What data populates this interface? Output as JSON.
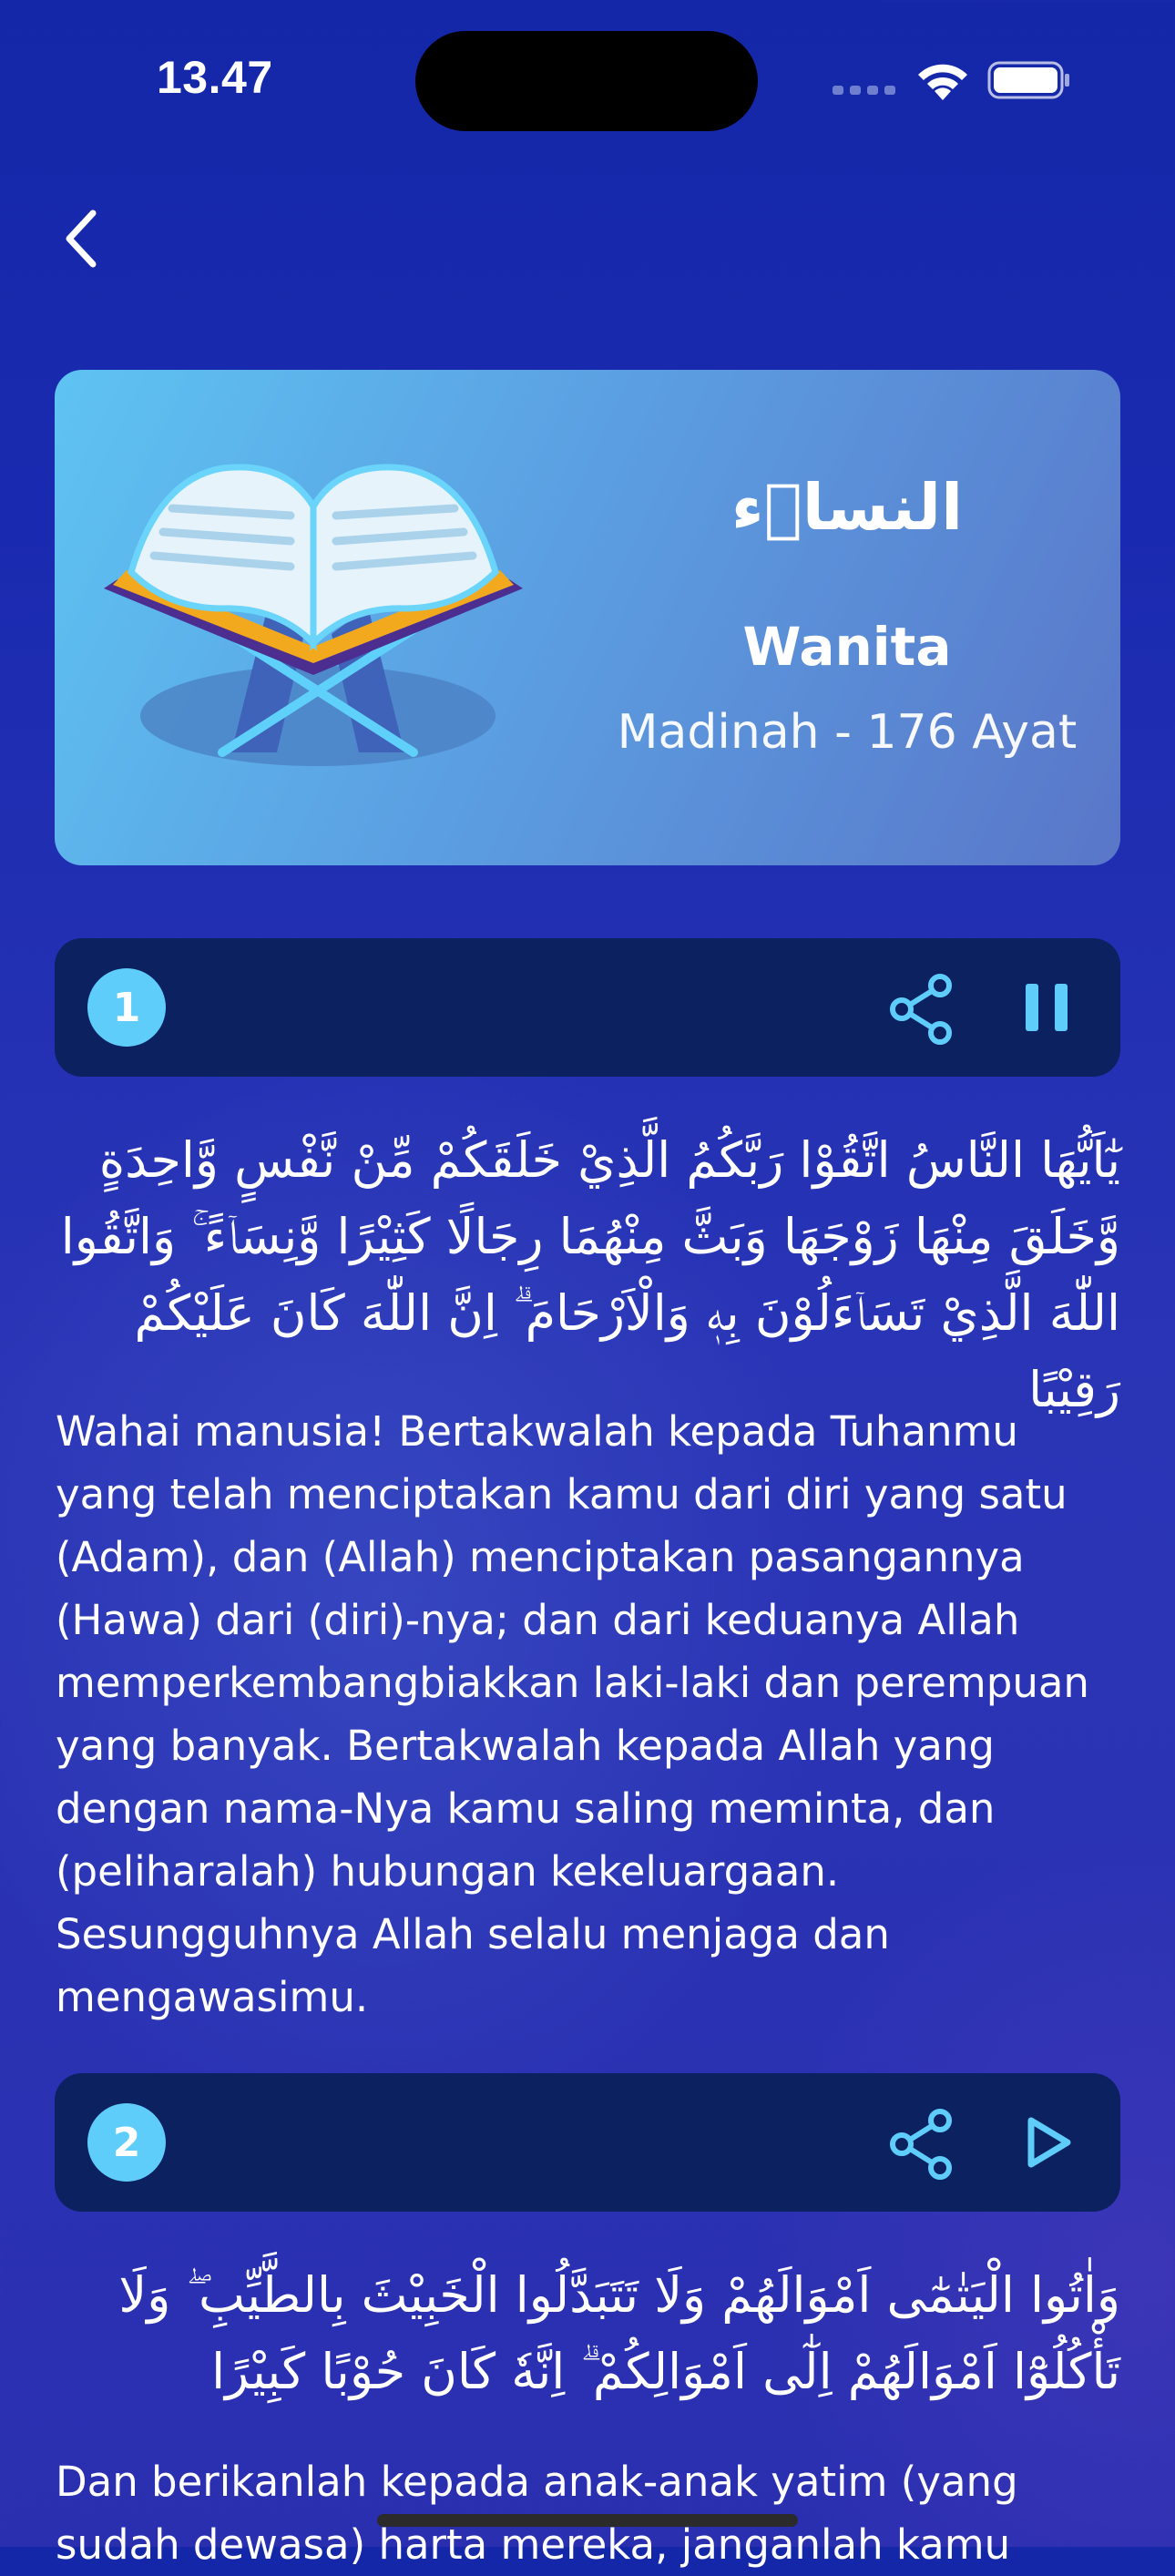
{
  "status_bar": {
    "time": "13.47"
  },
  "navigation": {
    "back_icon": "chevron-left-icon"
  },
  "surah": {
    "arabic_name": "النساۤء",
    "meaning": "Wanita",
    "info": "Madinah - 176 Ayat"
  },
  "ayahs": [
    {
      "number": "1",
      "arabic": "يٰٓاَيُّهَا النَّاسُ اتَّقُوْا رَبَّكُمُ الَّذِيْ خَلَقَكُمْ مِّنْ نَّفْسٍ وَّاحِدَةٍ وَّخَلَقَ مِنْهَا زَوْجَهَا وَبَثَّ مِنْهُمَا رِجَالًا كَثِيْرًا وَّنِسَاۤءً ۚ وَاتَّقُوا اللّٰهَ الَّذِيْ تَسَاۤءَلُوْنَ بِهٖ وَالْاَرْحَامَ ۗ اِنَّ اللّٰهَ كَانَ عَلَيْكُمْ رَقِيْبًا",
      "translation": "Wahai manusia! Bertakwalah kepada Tuhanmu yang telah menciptakan kamu dari diri yang satu (Adam), dan (Allah) menciptakan pasangannya (Hawa) dari (diri)-nya; dan dari keduanya Allah memperkembangbiakkan laki-laki dan perempuan yang banyak. Bertakwalah kepada Allah yang dengan nama-Nya kamu saling meminta, dan (peliharalah) hubungan kekeluargaan. Sesungguhnya Allah selalu menjaga dan mengawasimu.",
      "playback_icon": "pause-icon"
    },
    {
      "number": "2",
      "arabic": "وَاٰتُوا الْيَتٰمٰٓى اَمْوَالَهُمْ وَلَا تَتَبَدَّلُوا الْخَبِيْثَ بِالطَّيِّبِ ۖ وَلَا تَأْكُلُوْٓا اَمْوَالَهُمْ اِلٰٓى اَمْوَالِكُمْ ۗ اِنَّهٗ كَانَ حُوْبًا كَبِيْرًا",
      "translation": "Dan berikanlah kepada anak-anak yatim (yang sudah dewasa) harta mereka, janganlah kamu",
      "playback_icon": "play-icon"
    }
  ],
  "colors": {
    "background": "#1a2ab0",
    "card_gradient_start": "#5ec3f2",
    "card_gradient_end": "#5a76c8",
    "ayah_bar": "#0b2160",
    "accent": "#5fcdfa"
  }
}
